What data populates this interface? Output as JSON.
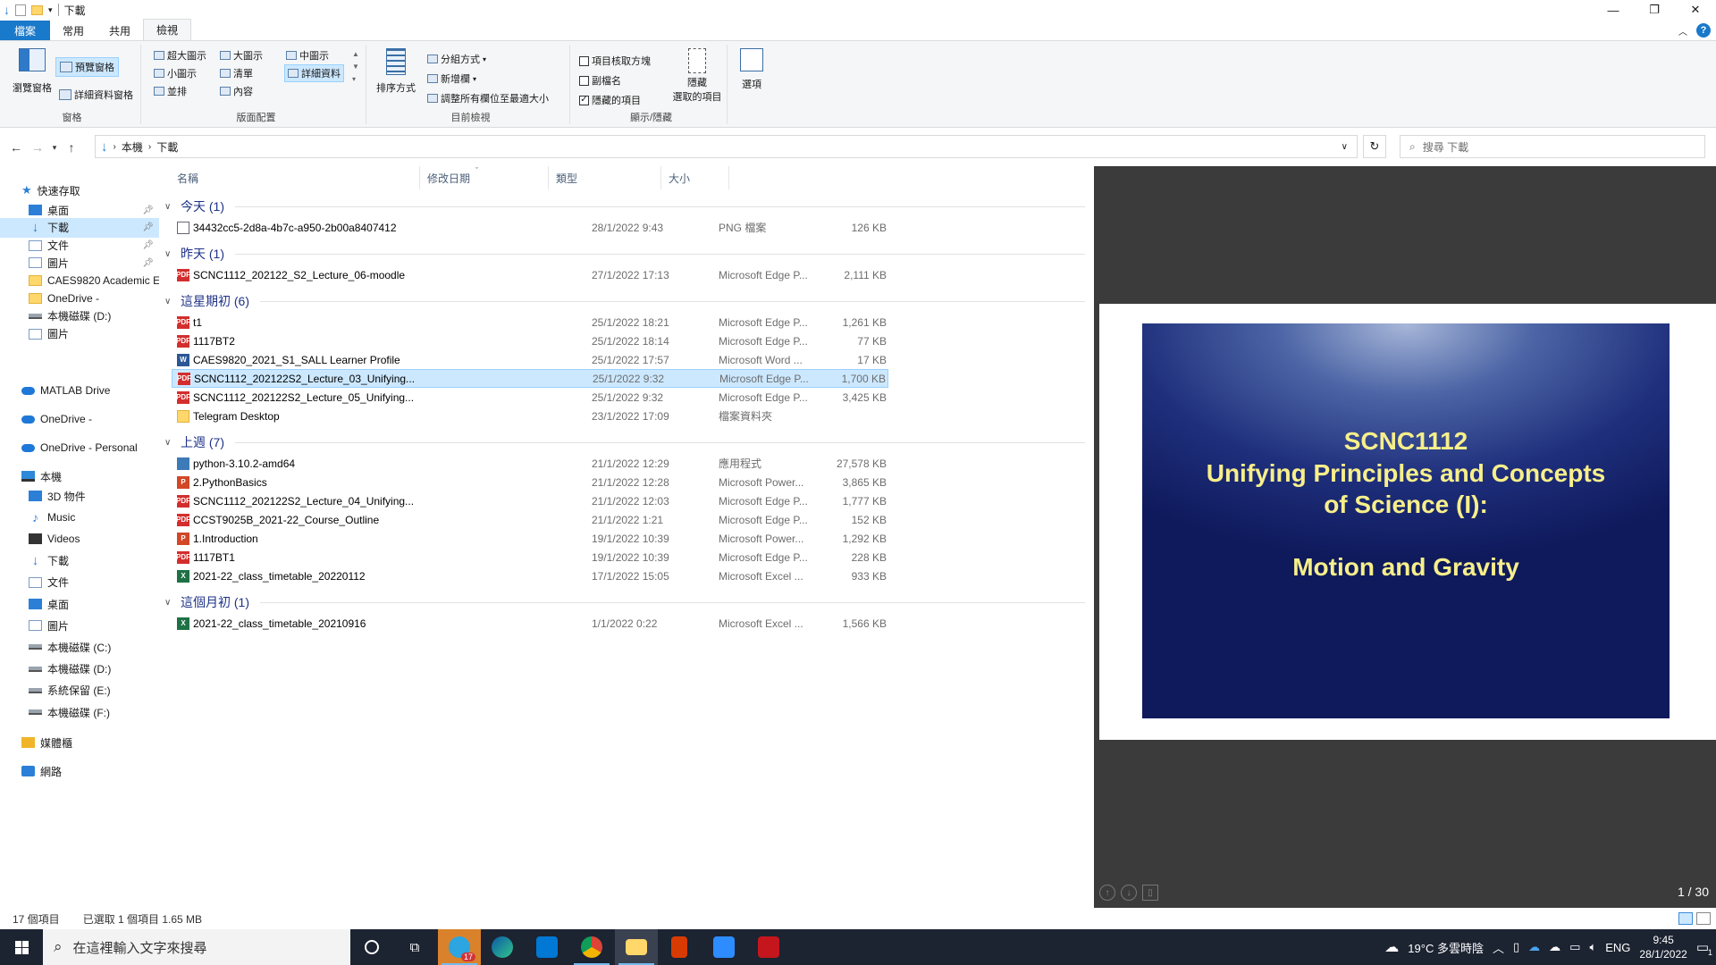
{
  "window": {
    "title": "下載",
    "controls": {
      "minimize": "—",
      "maximize": "❐",
      "close": "✕"
    }
  },
  "ribbon_tabs": [
    "檔案",
    "常用",
    "共用",
    "檢視"
  ],
  "ribbon": {
    "panes": {
      "nav_pane": "瀏覽窗格",
      "preview_pane": "預覽窗格",
      "details_pane": "詳細資料窗格",
      "group_label": "窗格"
    },
    "layout": {
      "xl": "超大圖示",
      "large": "大圖示",
      "medium": "中圖示",
      "small": "小圖示",
      "list": "清單",
      "details": "詳細資料",
      "tiles": "並排",
      "content": "內容",
      "group_label": "版面配置"
    },
    "current_view": {
      "sort": "排序方式",
      "group_by": "分組方式",
      "add_col": "新增欄",
      "size_all": "調整所有欄位至最適大小",
      "group_label": "目前檢視"
    },
    "show_hide": {
      "item_checkbox": "項目核取方塊",
      "extensions": "副檔名",
      "hidden_items": "隱藏的項目",
      "hide_selected_1": "隱藏",
      "hide_selected_2": "選取的項目",
      "group_label": "顯示/隱藏"
    },
    "options": "選項"
  },
  "address": {
    "crumbs": [
      "本機",
      "下載"
    ],
    "search_placeholder": "搜尋 下載"
  },
  "nav": {
    "quick_access": "快速存取",
    "items": [
      {
        "label": "桌面",
        "icon": "desktop-icon",
        "pinned": true
      },
      {
        "label": "下載",
        "icon": "download-icon",
        "pinned": true,
        "selected": true
      },
      {
        "label": "文件",
        "icon": "document-icon",
        "pinned": true
      },
      {
        "label": "圖片",
        "icon": "pictures-icon",
        "pinned": true
      },
      {
        "label": "CAES9820 Academic E",
        "icon": "folder-icon"
      },
      {
        "label": "OneDrive -",
        "icon": "folder-icon"
      },
      {
        "label": "本機磁碟 (D:)",
        "icon": "drive-icon"
      },
      {
        "label": "圖片",
        "icon": "pictures-icon"
      }
    ],
    "matlab": "MATLAB Drive",
    "onedrive1": "OneDrive -",
    "onedrive2": "OneDrive - Personal",
    "this_pc": "本機",
    "pc_items": [
      {
        "label": "3D 物件",
        "icon": "3d-objects-icon"
      },
      {
        "label": "Music",
        "icon": "music-icon"
      },
      {
        "label": "Videos",
        "icon": "videos-icon"
      },
      {
        "label": "下載",
        "icon": "download-icon"
      },
      {
        "label": "文件",
        "icon": "document-icon"
      },
      {
        "label": "桌面",
        "icon": "desktop-icon"
      },
      {
        "label": "圖片",
        "icon": "pictures-icon"
      },
      {
        "label": "本機磁碟 (C:)",
        "icon": "drive-icon"
      },
      {
        "label": "本機磁碟 (D:)",
        "icon": "drive-icon"
      },
      {
        "label": "系統保留 (E:)",
        "icon": "drive-icon"
      },
      {
        "label": "本機磁碟 (F:)",
        "icon": "drive-icon"
      }
    ],
    "libraries": "媒體櫃",
    "network": "網路"
  },
  "columns": {
    "name": "名稱",
    "date": "修改日期",
    "type": "類型",
    "size": "大小"
  },
  "groups": [
    {
      "label": "今天 (1)",
      "files": [
        {
          "name": "34432cc5-2d8a-4b7c-a950-2b00a8407412",
          "date": "28/1/2022 9:43",
          "type": "PNG 檔案",
          "size": "126 KB",
          "kind": "png"
        }
      ]
    },
    {
      "label": "昨天 (1)",
      "files": [
        {
          "name": "SCNC1112_202122_S2_Lecture_06-moodle",
          "date": "27/1/2022 17:13",
          "type": "Microsoft Edge P...",
          "size": "2,111 KB",
          "kind": "pdf"
        }
      ]
    },
    {
      "label": "這星期初 (6)",
      "files": [
        {
          "name": "t1",
          "date": "25/1/2022 18:21",
          "type": "Microsoft Edge P...",
          "size": "1,261 KB",
          "kind": "pdf"
        },
        {
          "name": "1117BT2",
          "date": "25/1/2022 18:14",
          "type": "Microsoft Edge P...",
          "size": "77 KB",
          "kind": "pdf"
        },
        {
          "name": "CAES9820_2021_S1_SALL Learner Profile",
          "date": "25/1/2022 17:57",
          "type": "Microsoft Word ...",
          "size": "17 KB",
          "kind": "word"
        },
        {
          "name": "SCNC1112_202122S2_Lecture_03_Unifying...",
          "date": "25/1/2022 9:32",
          "type": "Microsoft Edge P...",
          "size": "1,700 KB",
          "kind": "pdf",
          "selected": true
        },
        {
          "name": "SCNC1112_202122S2_Lecture_05_Unifying...",
          "date": "25/1/2022 9:32",
          "type": "Microsoft Edge P...",
          "size": "3,425 KB",
          "kind": "pdf"
        },
        {
          "name": "Telegram Desktop",
          "date": "23/1/2022 17:09",
          "type": "檔案資料夾",
          "size": "",
          "kind": "folder"
        }
      ]
    },
    {
      "label": "上週 (7)",
      "files": [
        {
          "name": "python-3.10.2-amd64",
          "date": "21/1/2022 12:29",
          "type": "應用程式",
          "size": "27,578 KB",
          "kind": "exe"
        },
        {
          "name": "2.PythonBasics",
          "date": "21/1/2022 12:28",
          "type": "Microsoft Power...",
          "size": "3,865 KB",
          "kind": "ppt"
        },
        {
          "name": "SCNC1112_202122S2_Lecture_04_Unifying...",
          "date": "21/1/2022 12:03",
          "type": "Microsoft Edge P...",
          "size": "1,777 KB",
          "kind": "pdf"
        },
        {
          "name": "CCST9025B_2021-22_Course_Outline",
          "date": "21/1/2022 1:21",
          "type": "Microsoft Edge P...",
          "size": "152 KB",
          "kind": "pdf"
        },
        {
          "name": "1.Introduction",
          "date": "19/1/2022 10:39",
          "type": "Microsoft Power...",
          "size": "1,292 KB",
          "kind": "ppt"
        },
        {
          "name": "1117BT1",
          "date": "19/1/2022 10:39",
          "type": "Microsoft Edge P...",
          "size": "228 KB",
          "kind": "pdf"
        },
        {
          "name": "2021-22_class_timetable_20220112",
          "date": "17/1/2022 15:05",
          "type": "Microsoft Excel ...",
          "size": "933 KB",
          "kind": "excel"
        }
      ]
    },
    {
      "label": "這個月初 (1)",
      "files": [
        {
          "name": "2021-22_class_timetable_20210916",
          "date": "1/1/2022 0:22",
          "type": "Microsoft Excel ...",
          "size": "1,566 KB",
          "kind": "excel"
        }
      ]
    }
  ],
  "preview": {
    "lines": [
      "SCNC1112",
      "Unifying Principles and Concepts",
      "of Science (I):",
      "Motion and Gravity"
    ],
    "page": "1 / 30"
  },
  "status": {
    "count": "17 個項目",
    "selected": "已選取 1 個項目 1.65 MB"
  },
  "taskbar": {
    "search_placeholder": "在這裡輸入文字來搜尋",
    "badge": "17",
    "weather": "19°C 多雲時陰",
    "lang": "ENG",
    "time": "9:45",
    "date": "28/1/2022",
    "notif": "1"
  },
  "colors": {
    "accent": "#1979ca",
    "selection": "#cce8ff",
    "group_header": "#1e3287"
  }
}
